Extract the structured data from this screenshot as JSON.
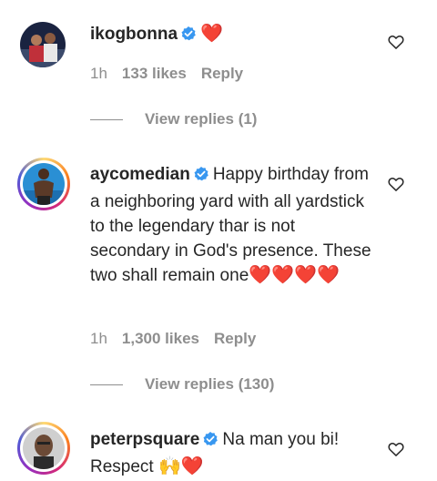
{
  "comments": [
    {
      "username": "ikogbonna",
      "text": "",
      "emoji": "❤️",
      "time": "1h",
      "likes": "133 likes",
      "reply_label": "Reply",
      "view_replies": "View replies (1)"
    },
    {
      "username": "aycomedian",
      "text": "Happy birthday from a neighboring yard with all yardstick to the legendary thar is not secondary in God's presence. These two shall remain one",
      "emoji": "❤️❤️❤️❤️",
      "time": "1h",
      "likes": "1,300 likes",
      "reply_label": "Reply",
      "view_replies": "View replies (130)"
    },
    {
      "username": "peterpsquare",
      "text": "Na man you bi! Respect",
      "emoji": "🙌❤️",
      "time": "",
      "likes": "",
      "reply_label": "",
      "view_replies": ""
    }
  ],
  "colors": {
    "verified": "#3897f0",
    "muted": "#8e8e8e",
    "heart": "#e0245e"
  },
  "icons": {
    "like": "heart-outline-icon",
    "verified": "verified-badge-icon"
  }
}
